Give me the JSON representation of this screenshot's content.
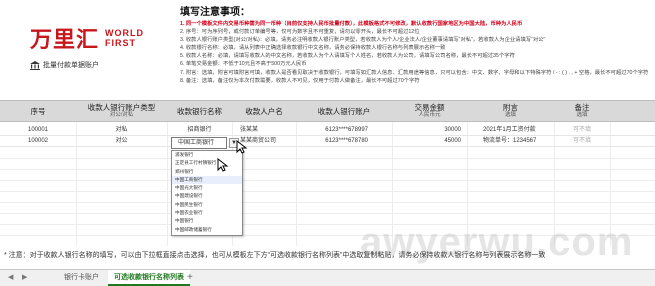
{
  "brand": {
    "name_cn": "万里汇",
    "name_en_line1": "WORLD",
    "name_en_line2": "FIRST",
    "subtitle": "批量付款单据账户"
  },
  "notes": {
    "title": "填写注意事项：",
    "items": [
      "1. 同一个模板文件内交易币种需为同一币种（目前仅支持人民币批量付款），此模板格式不可修改，默认收款行国家地区为中国大陆，币种为人民币",
      "2. 序号：可为序列号，或付款订单编号等，仅可为数字且不可重复，请勿以零开头，最长不可超过12位",
      "3. 收款人银行账户类型(对公/对私)：必填，请务必注明收款人银行账户类型，若收款人为个人/企业法人/企业董事请填写“对私”，若收款人为企业请填写“对公”",
      "4. 收款银行名称：必填，请从列表中正确选择收款银行中文名称，请务必保持收款人银行名称与列表展示名称一致",
      "5. 收款人名称：必填，请填写收款人的中文名称，若收款人为个人请填写个人姓名，若收款人为公司，请填写公司名称，最长不可超过35个字符",
      "6. 单笔交易金额：不低于10元且不高于500万元人民币",
      "7. 附言：选填，附言可填附言可填，收款人是否看见取决于收款银行，可填写如汇款人信息、汇款用途等信息，只可以包含：中文、数字、字母和以下特殊字符 / - : ( ) . , + 空格，最长不可超过70个字符",
      "8. 备注：选填，备注仅为本次付款需要，收款人不可见，仅用于付款人做备注，最长不可超过70个字符"
    ]
  },
  "table": {
    "headers": [
      {
        "label": "序号",
        "sub": ""
      },
      {
        "label": "收款人银行账户类型",
        "sub": "对公/对私"
      },
      {
        "label": "收款银行名称",
        "sub": "必填"
      },
      {
        "label": "收款人户名",
        "sub": "必填"
      },
      {
        "label": "收款人银行账户",
        "sub": "必填"
      },
      {
        "label": "交易金额",
        "sub": "人民币元"
      },
      {
        "label": "附言",
        "sub": "选填"
      },
      {
        "label": "备注",
        "sub": "选填"
      }
    ],
    "rows": [
      [
        "100001",
        "对私",
        "招商银行",
        "张某某",
        "6123****678997",
        "30000",
        "2021年1月工资付款",
        "可不填"
      ],
      [
        "100002",
        "对公",
        "中国工商银行",
        "某某商贸公司",
        "6123****678780",
        "45000",
        "物流单号：1234567",
        "可不填"
      ]
    ],
    "selected_value": "中国工商银行",
    "dropdown_options": [
      "浦发银行",
      "正定县工行村镇银行",
      "郑州银行",
      "中国工商银行",
      "中国光大银行",
      "中国建设银行",
      "中国民生银行",
      "中国农业银行",
      "中国银行",
      "中国邮政储蓄银行"
    ]
  },
  "footer": {
    "note": "* 注意：对于收款人银行名称的填写，可以由下拉框直接点击选择，也可从模板左下方“可选收款银行名称列表”中选取复制粘贴，请务必保持收款人银行名称与列表展示名称一致",
    "nav_prev": "◀",
    "nav_next": "▶",
    "tabs": [
      "银行卡账户",
      "可选收款银行名称列表"
    ],
    "add_tab": "+"
  },
  "watermark": "awyerwu.com",
  "colors": {
    "brand_red": "#c8161d",
    "notice_red": "#d0021b",
    "header_gray": "#d9d9d9",
    "active_tab_green": "#1f7a1f"
  }
}
